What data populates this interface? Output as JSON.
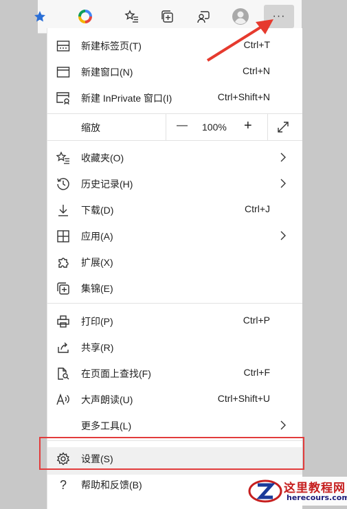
{
  "toolbar": {
    "more_label": "···",
    "icons": [
      "favorite-star-icon",
      "color-wheel-icon",
      "favorites-icon",
      "collections-icon",
      "feedback-icon",
      "profile-avatar-icon",
      "more-options-icon"
    ]
  },
  "menu": {
    "new_tab": {
      "label": "新建标签页(T)",
      "shortcut": "Ctrl+T"
    },
    "new_window": {
      "label": "新建窗口(N)",
      "shortcut": "Ctrl+N"
    },
    "new_inprivate": {
      "label": "新建 InPrivate 窗口(I)",
      "shortcut": "Ctrl+Shift+N"
    },
    "zoom": {
      "label": "缩放",
      "minus": "—",
      "value": "100%",
      "plus": "+"
    },
    "favorites": {
      "label": "收藏夹(O)"
    },
    "history": {
      "label": "历史记录(H)"
    },
    "downloads": {
      "label": "下载(D)",
      "shortcut": "Ctrl+J"
    },
    "apps": {
      "label": "应用(A)"
    },
    "extensions": {
      "label": "扩展(X)"
    },
    "collections": {
      "label": "集锦(E)"
    },
    "print": {
      "label": "打印(P)",
      "shortcut": "Ctrl+P"
    },
    "share": {
      "label": "共享(R)"
    },
    "find": {
      "label": "在页面上查找(F)",
      "shortcut": "Ctrl+F"
    },
    "read_aloud": {
      "label": "大声朗读(U)",
      "shortcut": "Ctrl+Shift+U"
    },
    "more_tools": {
      "label": "更多工具(L)"
    },
    "settings": {
      "label": "设置(S)"
    },
    "help": {
      "label": "帮助和反馈(B)"
    }
  },
  "annotation": {
    "arrow_color": "#e63a2e",
    "highlight_color": "#e23b3b"
  },
  "watermark": {
    "title": "这里教程网",
    "url": "herecours.com"
  }
}
